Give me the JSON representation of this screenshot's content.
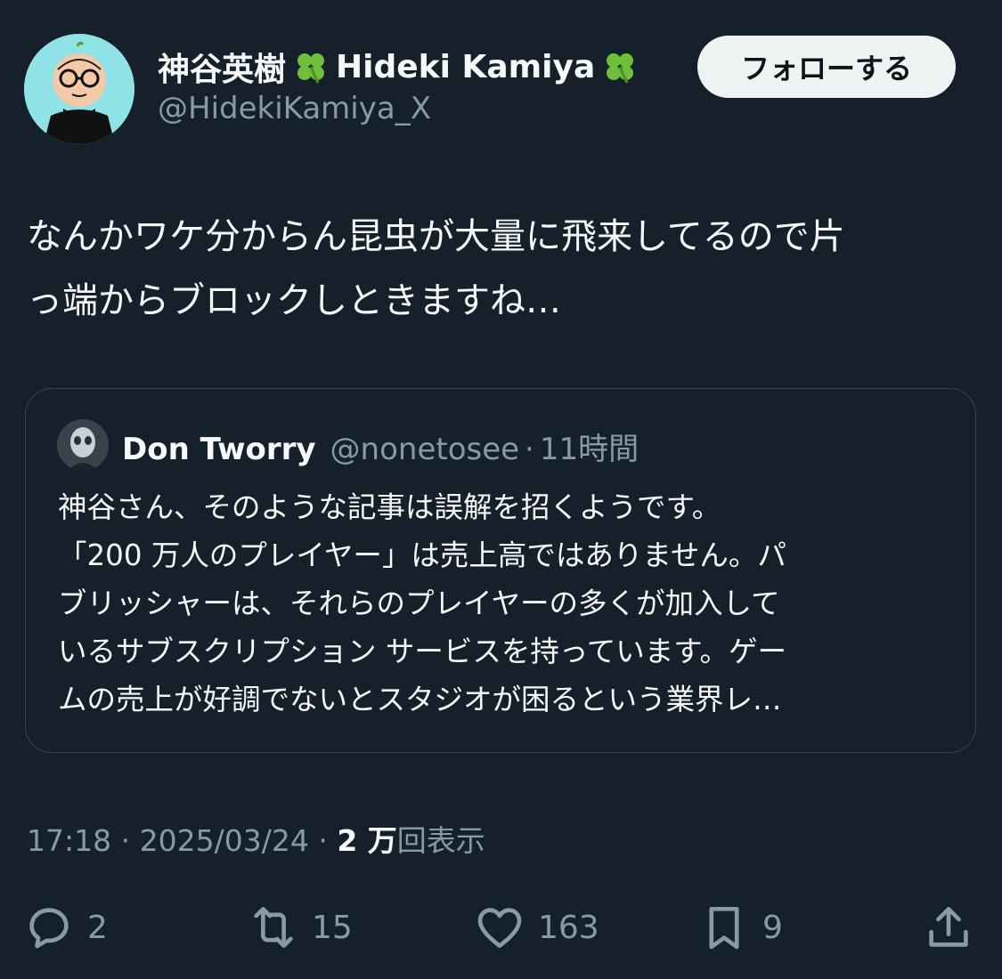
{
  "author": {
    "display_name": "神谷英樹",
    "display_name_latin": "Hideki Kamiya",
    "handle": "@HidekiKamiya_X",
    "follow_label": "フォローする"
  },
  "tweet": {
    "lines": [
      "なんかワケ分からん昆虫が大量に飛来してるので片",
      "っ端からブロックしときますね…"
    ]
  },
  "quote": {
    "name": "Don Tworry",
    "handle": "@nonetosee",
    "separator": "·",
    "time": "11時間",
    "lines": [
      "神谷さん、そのような記事は誤解を招くようです。",
      "「200 万人のプレイヤー」は売上高ではありません。パ",
      "ブリッシャーは、それらのプレイヤーの多くが加入して",
      "いるサブスクリプション サービスを持っています。ゲー",
      "ムの売上が好調でないとスタジオが困るという業界レ…"
    ]
  },
  "meta": {
    "time": "17:18",
    "date": "2025/03/24",
    "separator": "·",
    "views_count": "2 万",
    "views_label": "回表示"
  },
  "actions": {
    "replies": "2",
    "reposts": "15",
    "likes": "163",
    "bookmarks": "9"
  },
  "colors": {
    "background": "#15202b",
    "text": "#f7f9f9",
    "secondary": "#8b98a5",
    "border": "#38444d",
    "follow_bg": "#eff3f4",
    "clover": "#6fbf3a"
  }
}
